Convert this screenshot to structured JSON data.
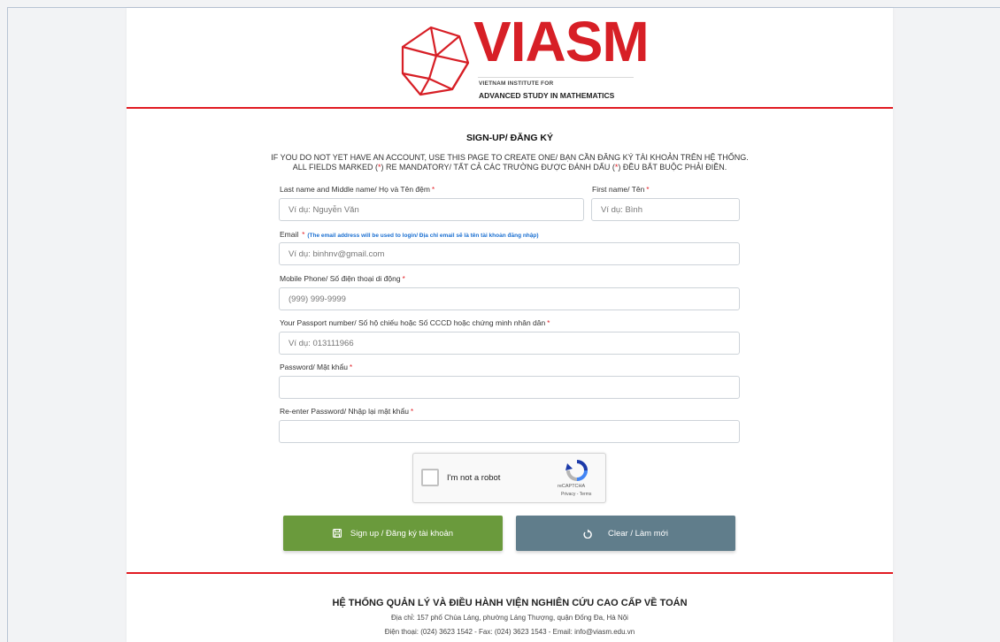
{
  "brand": {
    "name": "VIASM",
    "line1": "VIETNAM INSTITUTE FOR",
    "line2": "ADVANCED STUDY IN MATHEMATICS",
    "color": "#d71f26"
  },
  "form": {
    "title": "SIGN-UP/ ĐĂNG KÝ",
    "intro_line1": "IF YOU DO NOT YET HAVE AN ACCOUNT, USE THIS PAGE TO CREATE ONE/ BẠN CẦN ĐĂNG KÝ TÀI KHOẢN TRÊN HỆ THỐNG.",
    "intro_line2_a": "ALL FIELDS MARKED (",
    "intro_line2_star": "*",
    "intro_line2_b": ") RE MANDATORY/ TẤT CẢ CÁC TRƯỜNG ĐƯỢC ĐÁNH DẤU (",
    "intro_line2_c": ") ĐỀU BẮT BUỘC PHẢI ĐIỀN.",
    "required_mark": "*",
    "fields": {
      "last_name": {
        "label": "Last name and Middle name/ Họ và Tên đệm",
        "placeholder": "Ví dụ: Nguyễn Văn",
        "value": ""
      },
      "first_name": {
        "label": "First name/ Tên",
        "placeholder": "Ví dụ: Bình",
        "value": ""
      },
      "email": {
        "label": "Email",
        "note": "(The email address will be used to login/ Địa chỉ email sẽ là tên tài khoản đăng nhập)",
        "placeholder": "Ví dụ: binhnv@gmail.com",
        "value": ""
      },
      "phone": {
        "label": "Mobile Phone/ Số điện thoại di động",
        "placeholder": "(999) 999-9999",
        "value": ""
      },
      "passport": {
        "label": "Your Passport number/ Số hộ chiếu hoặc Số CCCD hoặc chứng minh nhân dân",
        "placeholder": "Ví dụ: 013111966",
        "value": ""
      },
      "password": {
        "label": "Password/ Mật khẩu",
        "placeholder": "",
        "value": ""
      },
      "password_confirm": {
        "label": "Re-enter Password/ Nhập lại mật khẩu",
        "placeholder": "",
        "value": ""
      }
    },
    "captcha": {
      "label": "I'm not a robot",
      "brand": "reCAPTCHA",
      "links": "Privacy - Terms",
      "checked": false
    },
    "buttons": {
      "signup": {
        "label": "Sign up / Đăng ký tài khoản",
        "color": "#6a9a3c",
        "icon": "save-icon"
      },
      "clear": {
        "label": "Clear / Làm mới",
        "color": "#607d8b",
        "icon": "refresh-icon"
      }
    }
  },
  "footer": {
    "title": "HỆ THỐNG QUẢN LÝ VÀ ĐIỀU HÀNH VIỆN NGHIÊN CỨU CAO CẤP VỀ TOÁN",
    "address": "Địa chỉ: 157 phố Chùa Láng, phường Láng Thượng, quận Đống Đa, Hà Nội",
    "contact": "Điện thoại: (024) 3623 1542 - Fax: (024) 3623 1543 - Email: info@viasm.edu.vn"
  },
  "colors": {
    "accent_red": "#e11b22",
    "note_blue": "#1a6fd1"
  }
}
